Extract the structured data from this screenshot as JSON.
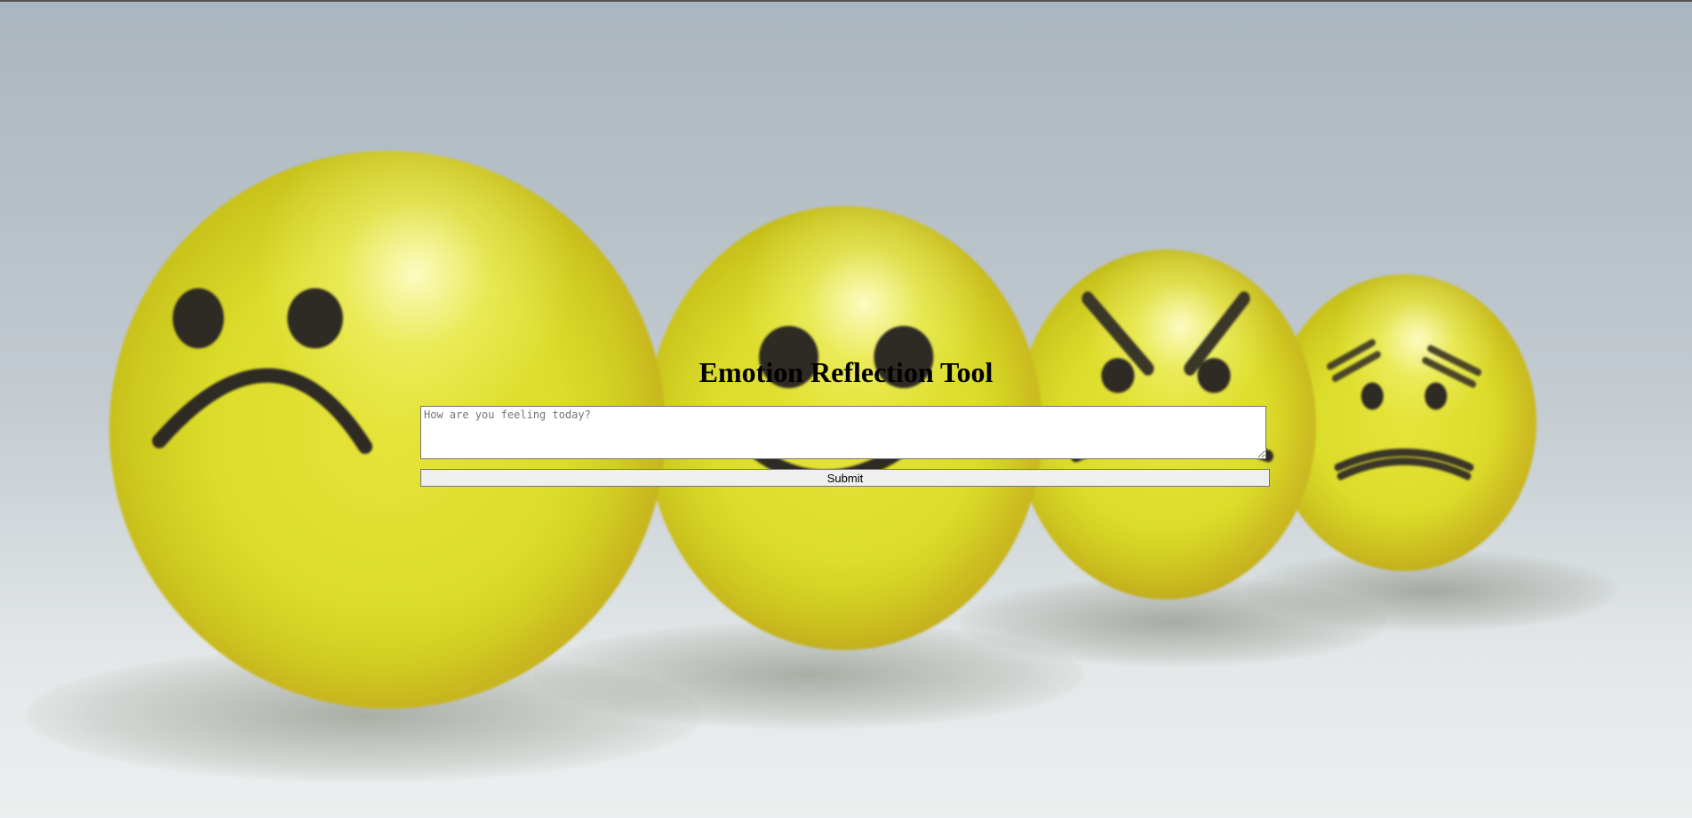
{
  "page": {
    "title": "Emotion Reflection Tool"
  },
  "form": {
    "input_placeholder": "How are you feeling today?",
    "input_value": "",
    "submit_label": "Submit"
  },
  "background": {
    "subject": "emoji balls",
    "faces": [
      "sad",
      "happy",
      "angry",
      "worried"
    ],
    "colors": {
      "ball": "#dcdc2a",
      "backdrop_top": "#aab6bf",
      "backdrop_bottom": "#ecefef",
      "feature": "#2e2a24"
    }
  }
}
